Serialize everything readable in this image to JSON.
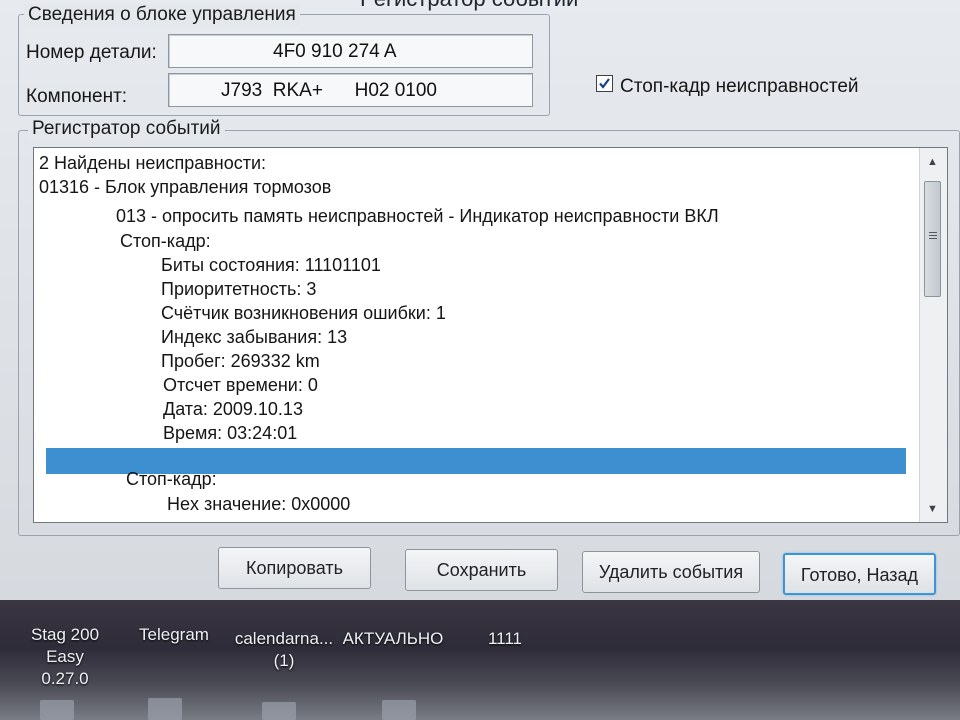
{
  "window": {
    "title": "Регистратор событий"
  },
  "control_info": {
    "legend": "Сведения о блоке управления",
    "part_label": "Номер детали:",
    "part_value": "4F0 910 274 A",
    "component_label": "Компонент:",
    "component_value": "J793  RKA+      H02 0100",
    "freeze_frame_checkbox": {
      "label": "Стоп-кадр неисправностей",
      "checked": true
    }
  },
  "event_log": {
    "legend": "Регистратор событий",
    "lines": [
      "2 Найдены неисправности:",
      "01316 - Блок управления тормозов",
      "013 - опросить память неисправностей - Индикатор неисправности ВКЛ",
      "Стоп-кадр:",
      "Биты состояния: 11101101",
      "Приоритетность: 3",
      "Счётчик возникновения ошибки: 1",
      "Индекс забывания: 13",
      "Пробег: 269332 km",
      "Отсчет времени: 0",
      "Дата: 2009.10.13",
      "Время: 03:24:01",
      "Стоп-кадр:",
      "Hex значение: 0x0000"
    ]
  },
  "buttons": {
    "copy": "Копировать",
    "save": "Сохранить",
    "delete_events": "Удалить события",
    "done_back": "Готово, Назад"
  },
  "taskbar": {
    "items": [
      {
        "line1": "Stag 200 Easy",
        "line2": "0.27.0"
      },
      {
        "line1": "Telegram",
        "line2": ""
      },
      {
        "line1": "calendarna...",
        "line2": "(1)"
      },
      {
        "line1": "АКТУАЛЬНО",
        "line2": ""
      },
      {
        "line1": "1111",
        "line2": ""
      }
    ]
  }
}
